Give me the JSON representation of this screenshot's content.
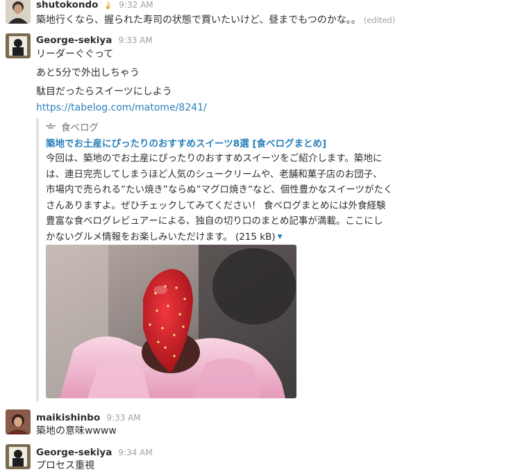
{
  "messages": [
    {
      "author": "shutokondo",
      "emoji": "🍦",
      "time": "9:32 AM",
      "lines": [
        "築地行くなら、握られた寿司の状態で買いたいけど、昼までもつのかな。。"
      ],
      "edited": "(edited)"
    },
    {
      "author": "George-sekiya",
      "time": "9:33 AM",
      "lines": [
        "リーダーぐぐって",
        "あと5分で外出しちゃう",
        "駄目だったらスイーツにしよう"
      ],
      "link": "https://tabelog.com/matome/8241/",
      "unfurl": {
        "service": "食べログ",
        "title": "築地でお土産にぴったりのおすすめスイーツ8選 [食べログまとめ]",
        "body": [
          "今回は、築地のでお土産にぴったりのおすすめスイーツをご紹介します。築地に",
          "は、連日完売してしまうほど人気のシュークリームや、老舗和菓子店のお団子、",
          "市場内で売られる”たい焼き”ならぬ”マグロ焼き”など、個性豊かなスイーツがたく",
          "さんありますよ。ぜひチェックしてみてください！ 食べログまとめには外食経験",
          "豊富な食べログレビュアーによる、独自の切り口のまとめ記事が満載。ここにし",
          "かないグルメ情報をお楽しみいただけます。"
        ],
        "size": "(215 kB)"
      }
    },
    {
      "author": "maikishinbo",
      "time": "9:33 AM",
      "lines": [
        "築地の意味wwww"
      ]
    },
    {
      "author": "George-sekiya",
      "time": "9:34 AM",
      "lines": [
        "プロセス重視"
      ]
    }
  ],
  "colors": {
    "link": "#2a80b9",
    "strawberry": "#d8262e",
    "mochi": "#f0b6cd"
  }
}
